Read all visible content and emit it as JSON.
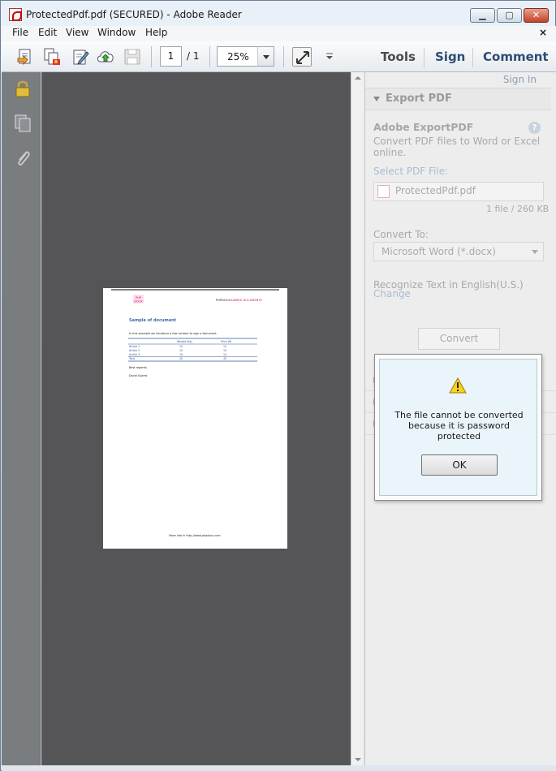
{
  "window": {
    "title": "ProtectedPdf.pdf (SECURED) - Adobe Reader",
    "min": "▁",
    "max": "▢",
    "close": "✕"
  },
  "menu": {
    "items": [
      "File",
      "Edit",
      "View",
      "Window",
      "Help"
    ],
    "close": "×"
  },
  "toolbar": {
    "page_current": "1",
    "page_total": "/ 1",
    "zoom": "25%",
    "tools": "Tools",
    "sign": "Sign",
    "comment": "Comment"
  },
  "panel": {
    "signin": "Sign In",
    "section": "Export PDF",
    "service_title": "Adobe ExportPDF",
    "service_desc_1": "Convert PDF files to Word or Excel",
    "service_desc_2": "online.",
    "help": "?",
    "select_label": "Select PDF File:",
    "file_name": "ProtectedPdf.pdf",
    "file_info": "1 file / 260 KB",
    "convert_to_label": "Convert To:",
    "convert_to_value": "Microsoft Word (*.docx)",
    "recognize_text": "Recognize Text in English(U.S.)",
    "change_link": "Change",
    "convert_button": "Convert"
  },
  "dialog": {
    "line1": "The file cannot be converted",
    "line2": "because it is password",
    "line3": "protected",
    "ok": "OK"
  },
  "document": {
    "logo_text_1": "PHP",
    "logo_text_2": "DOCX",
    "header_brand": "PHPDOCX",
    "header_tag": "SAMPLE DOCUMENTS",
    "heading": "Sample of document",
    "intro": "In this example we introduce a few content to sign a document.",
    "table": {
      "headers": [
        "",
        "Weight (Kg)",
        "Price (€)"
      ],
      "rows": [
        [
          "Article 1",
          "10",
          "12"
        ],
        [
          "Article 2",
          "20",
          "19"
        ],
        [
          "Article 3",
          "10",
          "14"
        ]
      ],
      "total": [
        "Total",
        "40",
        "45"
      ]
    },
    "regards": "Best regards,",
    "signer": "David Suarez",
    "footer": "More info in http://www.phpdocx.com"
  },
  "icons": [
    "create-pdf-icon",
    "combine-icon",
    "edit-icon",
    "upload-icon",
    "save-icon",
    "fit-page-icon",
    "lock-icon",
    "pages-icon",
    "attachment-icon",
    "warning-icon"
  ]
}
